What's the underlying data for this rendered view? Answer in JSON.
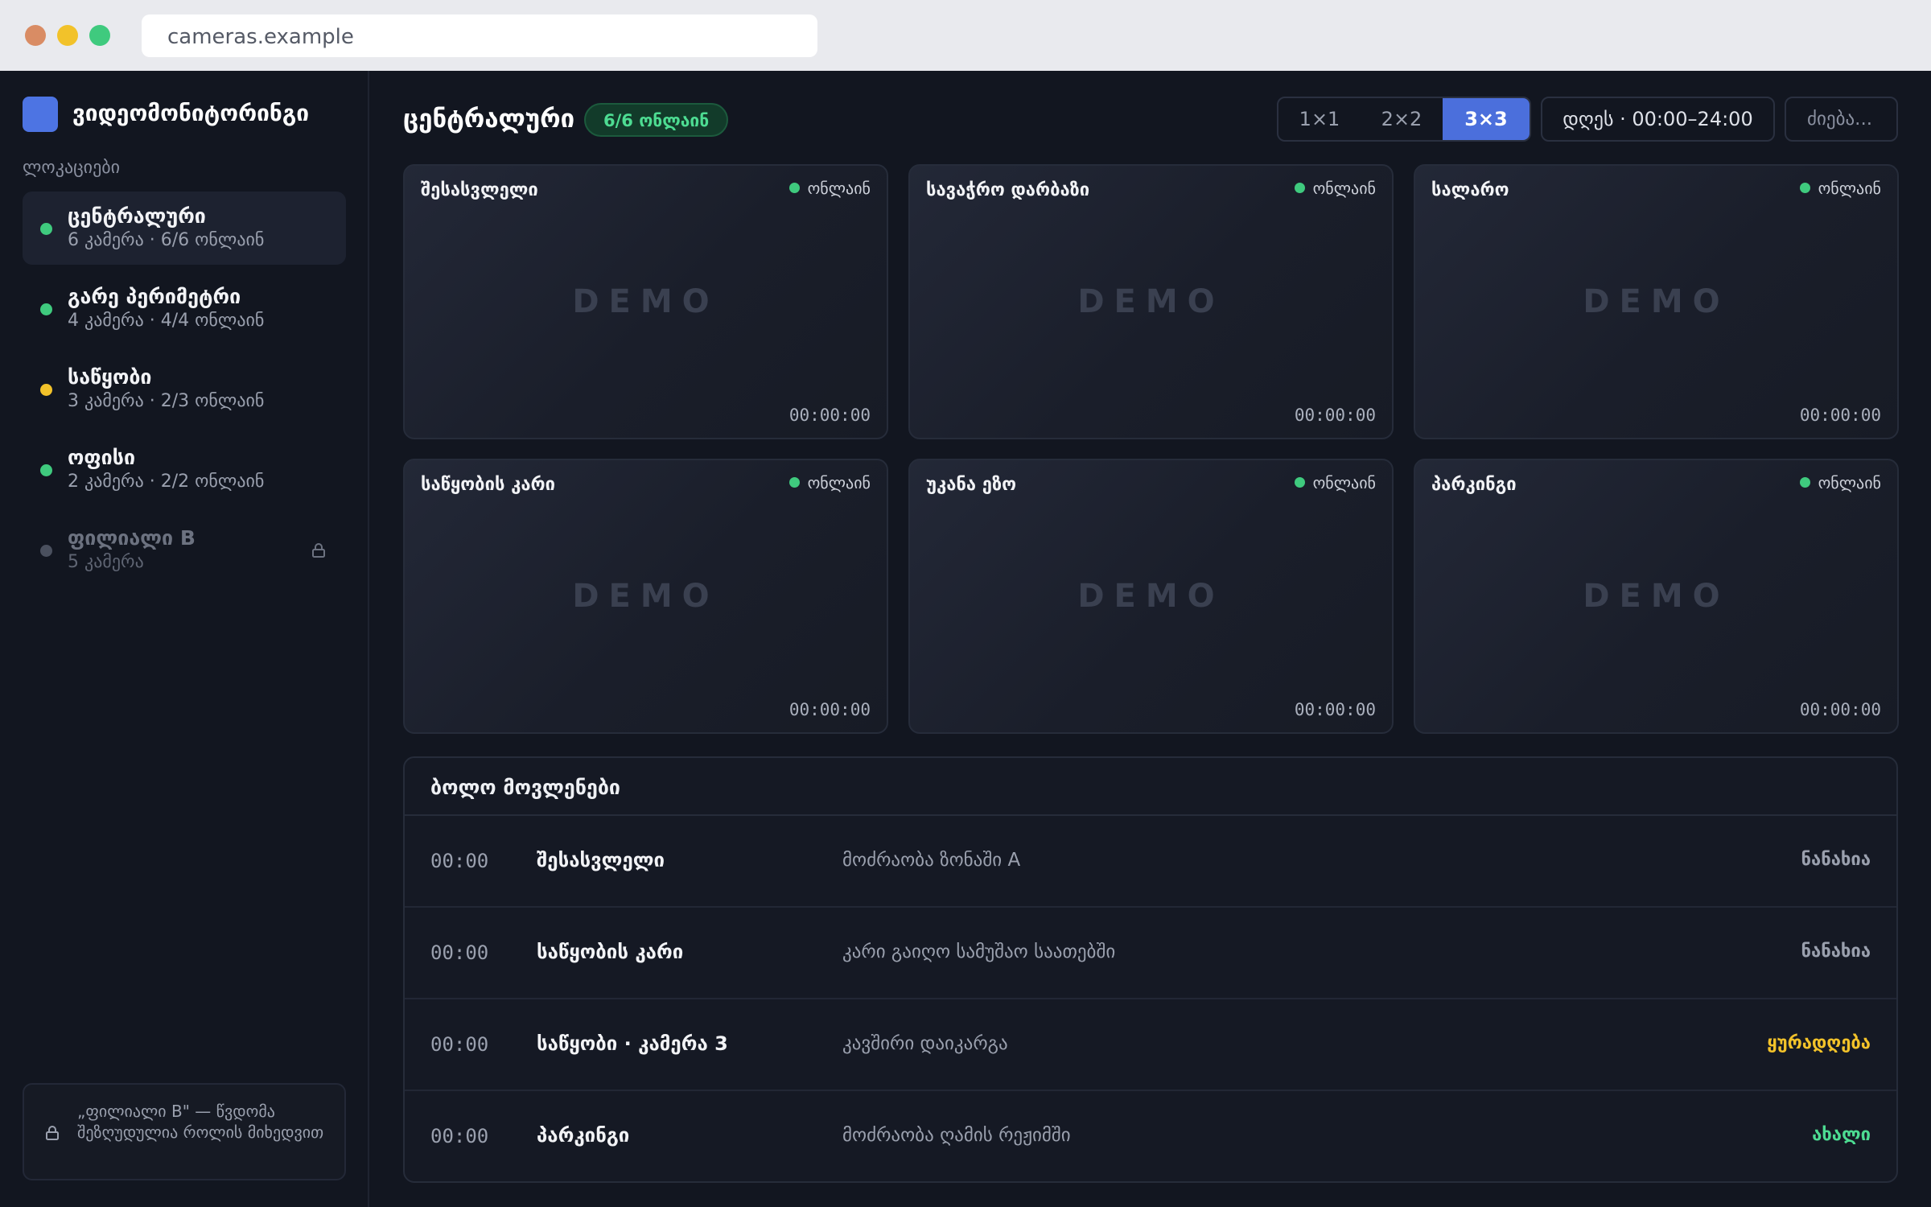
{
  "browser": {
    "url": "cameras.example"
  },
  "app": {
    "name": "ვიდეომონიტორინგი",
    "brand_color": "#4d74e3"
  },
  "sidebar": {
    "section_label": "ლოკაციები",
    "locations": [
      {
        "name": "ცენტრალური",
        "sub": "6 კამერა · 6/6 ონლაინ",
        "status_color": "#3fca7e",
        "active": true
      },
      {
        "name": "გარე პერიმეტრი",
        "sub": "4 კამერა · 4/4 ონლაინ",
        "status_color": "#3fca7e"
      },
      {
        "name": "საწყობი",
        "sub": "3 კამერა · 2/3 ონლაინ",
        "status_color": "#f2c22a"
      },
      {
        "name": "ოფისი",
        "sub": "2 კამერა · 2/2 ონლაინ",
        "status_color": "#3fca7e"
      },
      {
        "name": "ფილიალი B",
        "sub": "5 კამერა",
        "status_color": "#4a505e",
        "locked": true,
        "icon": "lock-icon"
      }
    ],
    "note": {
      "icon": "lock-icon",
      "text": "„ფილიალი B\" — წვდომა შეზღუდულია როლის მიხედვით"
    }
  },
  "header": {
    "title": "ცენტრალური",
    "online_badge": "6/6 ონლაინ",
    "layout_options": [
      "1×1",
      "2×2",
      "3×3"
    ],
    "layout_selected": "3×3",
    "time_range": "დღეს · 00:00–24:00",
    "search_placeholder": "ძიება..."
  },
  "cameras": [
    {
      "name": "შესასვლელი",
      "status": "ონლაინ",
      "overlay": "DEMO",
      "time": "00:00:00"
    },
    {
      "name": "სავაჭრო დარბაზი",
      "status": "ონლაინ",
      "overlay": "DEMO",
      "time": "00:00:00"
    },
    {
      "name": "სალარო",
      "status": "ონლაინ",
      "overlay": "DEMO",
      "time": "00:00:00"
    },
    {
      "name": "საწყობის კარი",
      "status": "ონლაინ",
      "overlay": "DEMO",
      "time": "00:00:00"
    },
    {
      "name": "უკანა ეზო",
      "status": "ონლაინ",
      "overlay": "DEMO",
      "time": "00:00:00"
    },
    {
      "name": "პარკინგი",
      "status": "ონლაინ",
      "overlay": "DEMO",
      "time": "00:00:00"
    }
  ],
  "events": {
    "title": "ბოლო მოვლენები",
    "rows": [
      {
        "time": "00:00",
        "camera": "შესასვლელი",
        "description": "მოძრაობა ზონაში A",
        "status": "ნანახია",
        "status_color": "#9aa0ae"
      },
      {
        "time": "00:00",
        "camera": "საწყობის კარი",
        "description": "კარი გაიღო სამუშაო საათებში",
        "status": "ნანახია",
        "status_color": "#9aa0ae"
      },
      {
        "time": "00:00",
        "camera": "საწყობი · კამერა 3",
        "description": "კავშირი დაიკარგა",
        "status": "ყურადღება",
        "status_color": "#f2c22a"
      },
      {
        "time": "00:00",
        "camera": "პარკინგი",
        "description": "მოძრაობა ღამის რეჟიმში",
        "status": "ახალი",
        "status_color": "#4ddc92"
      }
    ]
  }
}
